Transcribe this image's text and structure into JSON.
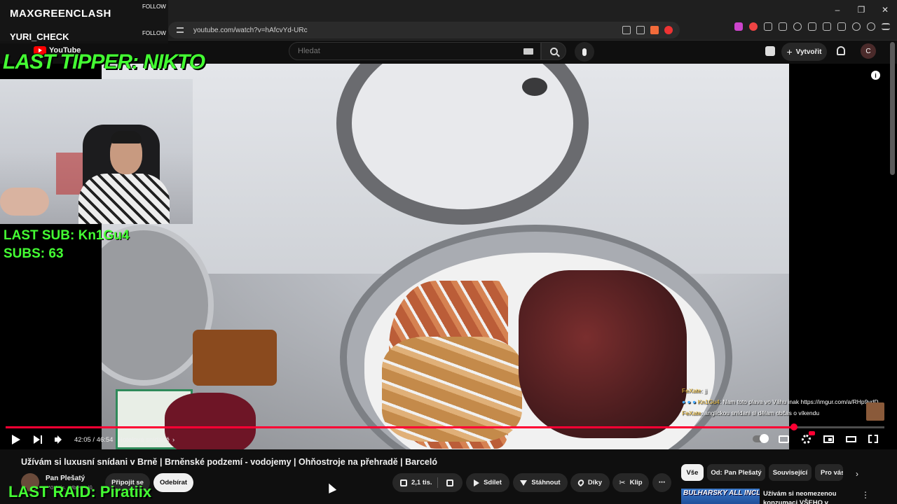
{
  "browser": {
    "url": "youtube.com/watch?v=hAfcvYd-URc",
    "window_controls": [
      "–",
      "❐",
      "✕"
    ]
  },
  "youtube": {
    "logo_text": "YouTube",
    "search_placeholder": "Hledat",
    "create_label": "Vytvořit",
    "avatar_letter": "C"
  },
  "overlay": {
    "follower1": "MAXGREENCLASH",
    "follower2": "YURI_CHECK",
    "follow_label": "FOLLOW",
    "last_tipper": "LAST TIPPER: NIKTO",
    "last_sub": "LAST SUB: Kn1Gu4",
    "subs": "SUBS: 63",
    "last_raid": "LAST RAID: Piratiix",
    "accent_color": "#44ff33"
  },
  "chat": [
    {
      "user": "FeXate",
      "message": ": jj"
    },
    {
      "user": "Kn1Gu4",
      "message": ": Nam toto plava vo Váhu inak https://imgur.com/a/RHp9ydD"
    },
    {
      "user": "FeXate",
      "message": ": anglickou snídani si dělam občas o víkendu"
    }
  ],
  "player": {
    "time": "42:05 / 46:54",
    "chapter": "Hotelová snídaně",
    "progress": 0.897
  },
  "video": {
    "title": "Užívám si luxusní snídani v Brně | Brněnské podzemí - vodojemy | Ohňostroje na přehradě | Barceló",
    "channel_name": "Pan Plešatý",
    "channel_subs": "40,1 tis. odběratelů",
    "join_label": "Připojit se",
    "subscribe_label": "Odebírat",
    "likes": "2,1 tis.",
    "share_label": "Sdílet",
    "download_label": "Stáhnout",
    "thanks_label": "Díky",
    "clip_label": "Klip",
    "more_label": "⋯"
  },
  "chips": [
    "Vše",
    "Od: Pan Plešatý",
    "Související",
    "Pro vás"
  ],
  "recommended": {
    "thumb_text": "BULHARSKY ALL INCLUSIVE",
    "title": "Užívám si neomezenou konzumaci VŠEHO v"
  }
}
